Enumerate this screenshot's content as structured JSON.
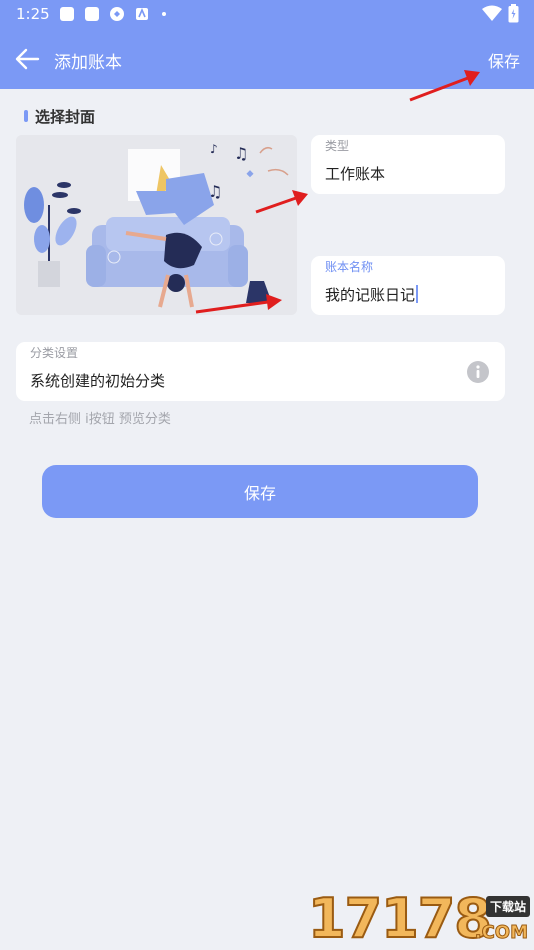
{
  "status": {
    "time": "1:25"
  },
  "appbar": {
    "title": "添加账本",
    "save_label": "保存"
  },
  "section": {
    "title": "选择封面"
  },
  "type_field": {
    "label": "类型",
    "value": "工作账本"
  },
  "name_field": {
    "label": "账本名称",
    "value": "我的记账日记"
  },
  "category_field": {
    "label": "分类设置",
    "value": "系统创建的初始分类"
  },
  "hint": "点击右侧 i按钮 预览分类",
  "save_button": {
    "label": "保存"
  },
  "watermark": {
    "number": "17178",
    "sub": "下载站",
    "domain": ".COM"
  },
  "colors": {
    "accent": "#7b99f5",
    "background": "#eef0f5",
    "card": "#ffffff",
    "annotation_arrow": "#e01e1e"
  },
  "icons": [
    "back-arrow-icon",
    "info-icon",
    "wifi-icon",
    "battery-icon"
  ]
}
